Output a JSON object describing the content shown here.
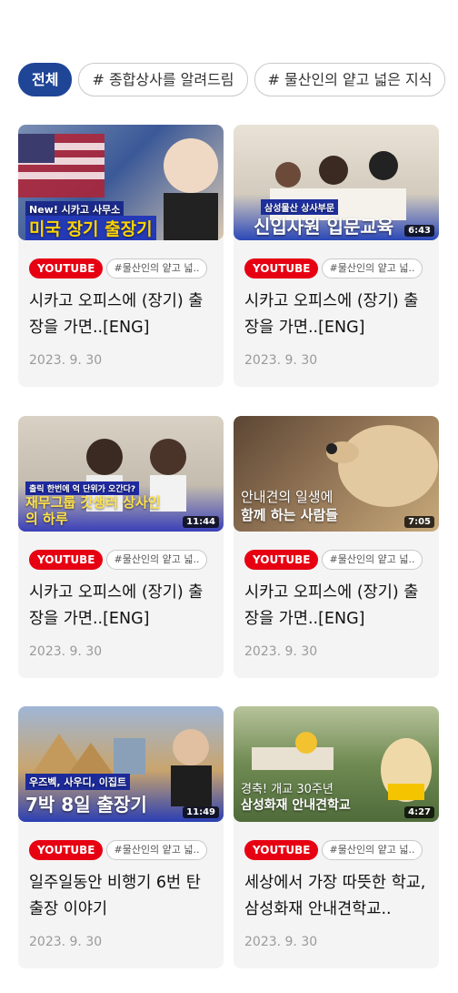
{
  "filters": [
    {
      "label": "전체",
      "active": true
    },
    {
      "label": "# 종합상사를 알려드림",
      "active": false
    },
    {
      "label": "# 물산인의 얕고 넓은 지식",
      "active": false
    }
  ],
  "cards": [
    {
      "source": "YOUTUBE",
      "category": "#물산인의 얕고 넓..",
      "title": "시카고 오피스에 (장기) 출장을 가면..[ENG]",
      "date": "2023. 9. 30",
      "duration": "",
      "thumb_text_top": "New! 시카고 사무소",
      "thumb_text_main": "미국 장기 출장기",
      "thumb_colors": [
        "#3b5998",
        "#d9c9b3"
      ]
    },
    {
      "source": "YOUTUBE",
      "category": "#물산인의 얕고 넓..",
      "title": "시카고 오피스에 (장기) 출장을 가면..[ENG]",
      "date": "2023. 9. 30",
      "duration": "6:43",
      "thumb_text_top": "삼성물산 상사부문",
      "thumb_text_main": "신입사원 입문교육",
      "thumb_colors": [
        "#2b48b8",
        "#e9e2d6"
      ]
    },
    {
      "source": "YOUTUBE",
      "category": "#물산인의 얕고 넓..",
      "title": "시카고 오피스에 (장기) 출장을 가면..[ENG]",
      "date": "2023. 9. 30",
      "duration": "11:44",
      "thumb_text_top": "출릭 한번에 억 단위가 오간다?",
      "thumb_text_main": "재무그룹 갓생러 상사인의 하루",
      "thumb_colors": [
        "#3a3fb8",
        "#d8d1c4"
      ]
    },
    {
      "source": "YOUTUBE",
      "category": "#물산인의 얕고 넓..",
      "title": "시카고 오피스에 (장기) 출장을 가면..[ENG]",
      "date": "2023. 9. 30",
      "duration": "7:05",
      "thumb_text_top": "안내견의 일생에",
      "thumb_text_main": "함께 하는 사람들",
      "thumb_colors": [
        "#6e5a45",
        "#c8a97a"
      ]
    },
    {
      "source": "YOUTUBE",
      "category": "#물산인의 얕고 넓..",
      "title": "일주일동안 비행기 6번 탄 출장 이야기",
      "date": "2023. 9. 30",
      "duration": "11:49",
      "thumb_text_top": "우즈벡, 사우디, 이집트",
      "thumb_text_main": "7박 8일 출장기",
      "thumb_colors": [
        "#2b3fb3",
        "#c9a56e"
      ]
    },
    {
      "source": "YOUTUBE",
      "category": "#물산인의 얕고 넓..",
      "title": "세상에서 가장 따뜻한 학교, 삼성화재 안내견학교..",
      "date": "2023. 9. 30",
      "duration": "4:27",
      "thumb_text_top": "경축! 개교 30주년",
      "thumb_text_main": "삼성화재 안내견학교",
      "thumb_colors": [
        "#4f6b3a",
        "#b7c39a"
      ]
    }
  ]
}
